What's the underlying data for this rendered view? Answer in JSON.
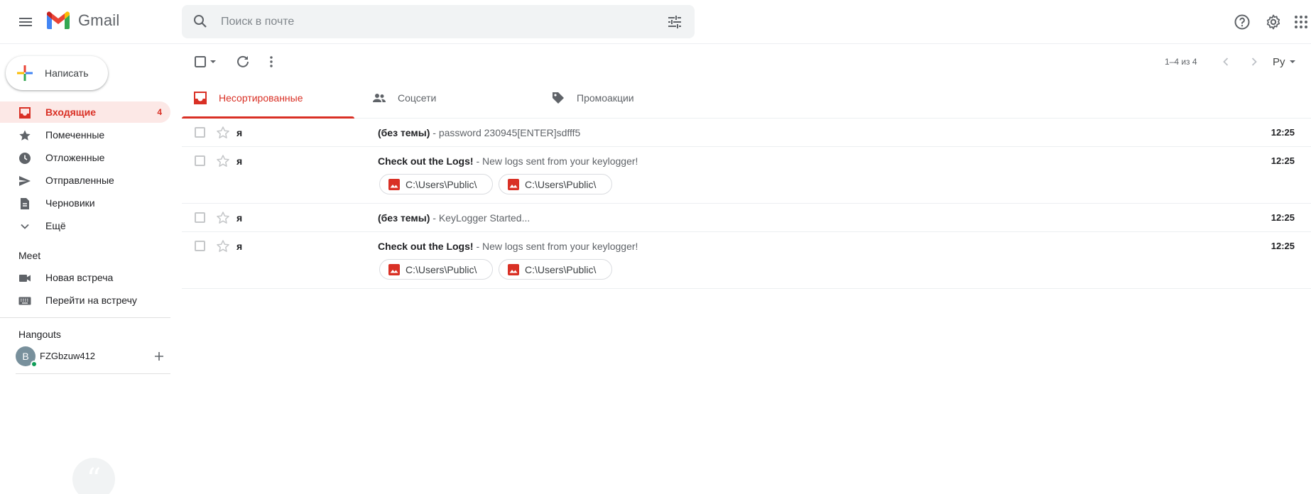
{
  "app": {
    "name": "Gmail"
  },
  "search": {
    "placeholder": "Поиск в почте"
  },
  "compose": {
    "label": "Написать"
  },
  "sidebar": {
    "items": [
      {
        "label": "Входящие",
        "count": "4",
        "icon": "inbox-icon",
        "active": true
      },
      {
        "label": "Помеченные",
        "icon": "star-icon"
      },
      {
        "label": "Отложенные",
        "icon": "clock-icon"
      },
      {
        "label": "Отправленные",
        "icon": "send-icon"
      },
      {
        "label": "Черновики",
        "icon": "draft-icon"
      },
      {
        "label": "Ещё",
        "icon": "chevron-down-icon"
      }
    ],
    "meet": {
      "title": "Meet",
      "items": [
        {
          "label": "Новая встреча",
          "icon": "video-icon"
        },
        {
          "label": "Перейти на встречу",
          "icon": "keyboard-icon"
        }
      ]
    },
    "hangouts": {
      "title": "Hangouts",
      "user": {
        "initial": "B",
        "name": "FZGbzuw412"
      }
    }
  },
  "toolbar": {
    "page_count": "1–4 из 4",
    "input_lang": "Ру"
  },
  "tabs": [
    {
      "label": "Несортированные",
      "icon": "inbox-icon",
      "active": true
    },
    {
      "label": "Соцсети",
      "icon": "people-icon"
    },
    {
      "label": "Промоакции",
      "icon": "tag-icon"
    }
  ],
  "messages": [
    {
      "sender": "я",
      "subject": "(без темы)",
      "snippet": " - password 230945[ENTER]sdfff5",
      "time": "12:25",
      "attachments": []
    },
    {
      "sender": "я",
      "subject": "Check out the Logs!",
      "snippet": " - New logs sent from your keylogger!",
      "time": "12:25",
      "attachments": [
        "C:\\Users\\Public\\",
        "C:\\Users\\Public\\"
      ]
    },
    {
      "sender": "я",
      "subject": "(без темы)",
      "snippet": " - KeyLogger Started...",
      "time": "12:25",
      "attachments": []
    },
    {
      "sender": "я",
      "subject": "Check out the Logs!",
      "snippet": " - New logs sent from your keylogger!",
      "time": "12:25",
      "attachments": [
        "C:\\Users\\Public\\",
        "C:\\Users\\Public\\"
      ]
    }
  ],
  "colors": {
    "accent": "#d93025",
    "active_bg": "#fce8e6",
    "text": "#202124",
    "muted": "#5f6368"
  }
}
